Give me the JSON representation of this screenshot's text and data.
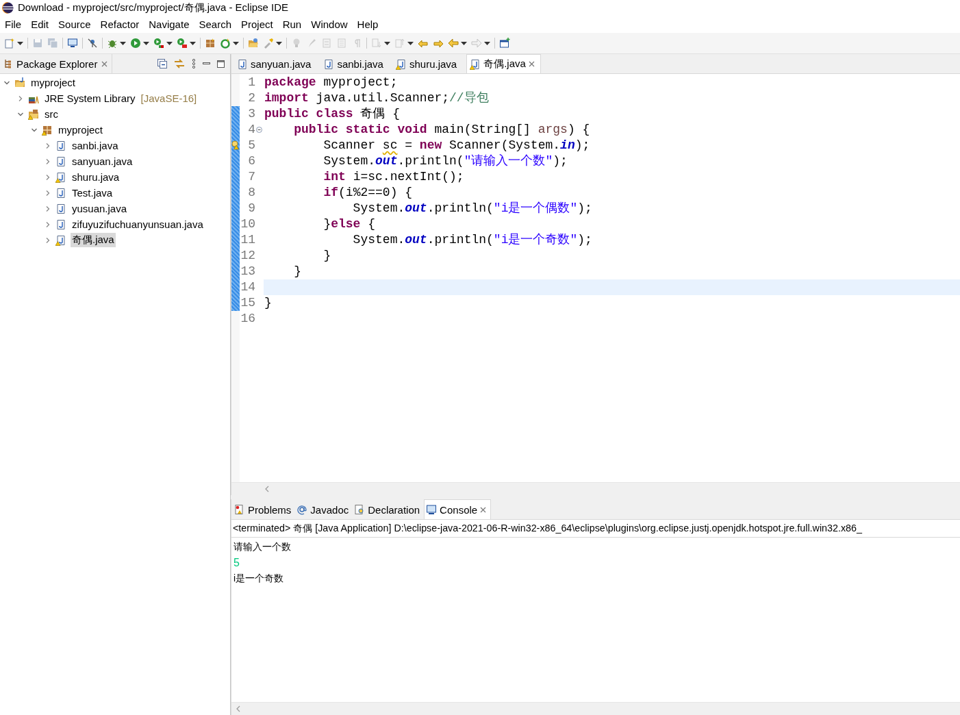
{
  "window": {
    "title": "Download - myproject/src/myproject/奇偶.java - Eclipse IDE"
  },
  "menu": [
    "File",
    "Edit",
    "Source",
    "Refactor",
    "Navigate",
    "Search",
    "Project",
    "Run",
    "Window",
    "Help"
  ],
  "toolbar": [
    {
      "kind": "new-document",
      "disabled": false,
      "menu": true,
      "separator_before": false
    },
    {
      "kind": "floppy-disk",
      "disabled": true,
      "menu": false,
      "separator_before": true
    },
    {
      "kind": "floppy-disks",
      "disabled": true,
      "menu": false,
      "separator_before": false
    },
    {
      "kind": "monitor",
      "disabled": false,
      "menu": false,
      "separator_before": true
    },
    {
      "kind": "crossed-pin",
      "disabled": false,
      "menu": false,
      "separator_before": true
    },
    {
      "kind": "bug",
      "disabled": false,
      "menu": true,
      "separator_before": true
    },
    {
      "kind": "play",
      "disabled": false,
      "menu": true,
      "separator_before": false
    },
    {
      "kind": "play-chart",
      "disabled": false,
      "menu": true,
      "separator_before": false
    },
    {
      "kind": "play-toolbox",
      "disabled": false,
      "menu": true,
      "separator_before": false
    },
    {
      "kind": "package-box",
      "disabled": false,
      "menu": false,
      "separator_before": true
    },
    {
      "kind": "circle-arrow",
      "disabled": false,
      "menu": true,
      "separator_before": false
    },
    {
      "kind": "open-folder",
      "disabled": false,
      "menu": false,
      "separator_before": true
    },
    {
      "kind": "flashlight",
      "disabled": false,
      "menu": true,
      "separator_before": false
    },
    {
      "kind": "lightbulb",
      "disabled": true,
      "menu": false,
      "separator_before": true
    },
    {
      "kind": "brush",
      "disabled": true,
      "menu": false,
      "separator_before": false
    },
    {
      "kind": "document-arrows",
      "disabled": true,
      "menu": false,
      "separator_before": false
    },
    {
      "kind": "document-lines",
      "disabled": true,
      "menu": false,
      "separator_before": false
    },
    {
      "kind": "pilcrow",
      "disabled": true,
      "menu": false,
      "separator_before": false
    },
    {
      "kind": "arrow-down-document",
      "disabled": true,
      "menu": true,
      "separator_before": true
    },
    {
      "kind": "arrow-up-document",
      "disabled": true,
      "menu": true,
      "separator_before": false
    },
    {
      "kind": "arrow-star-left",
      "disabled": false,
      "menu": false,
      "separator_before": false
    },
    {
      "kind": "arrow-star-right",
      "disabled": false,
      "menu": false,
      "separator_before": false
    },
    {
      "kind": "arrow-left",
      "disabled": false,
      "menu": true,
      "separator_before": false
    },
    {
      "kind": "arrow-right",
      "disabled": true,
      "menu": true,
      "separator_before": false
    },
    {
      "kind": "window-plus",
      "disabled": false,
      "menu": false,
      "separator_before": true
    }
  ],
  "package_explorer": {
    "title": "Package Explorer",
    "tree": [
      {
        "label": "myproject",
        "kind": "project",
        "expanded": true,
        "selected": false,
        "warning": false,
        "children": [
          {
            "label": "JRE System Library",
            "suffix": "[JavaSE-16]",
            "kind": "library",
            "expanded": false,
            "selected": false,
            "warning": false
          },
          {
            "label": "src",
            "kind": "source-folder",
            "expanded": true,
            "selected": false,
            "warning": true,
            "children": [
              {
                "label": "myproject",
                "kind": "package",
                "expanded": true,
                "selected": false,
                "warning": true,
                "children": [
                  {
                    "label": "sanbi.java",
                    "kind": "java-file",
                    "expanded": false,
                    "selected": false,
                    "warning": false
                  },
                  {
                    "label": "sanyuan.java",
                    "kind": "java-file",
                    "expanded": false,
                    "selected": false,
                    "warning": false
                  },
                  {
                    "label": "shuru.java",
                    "kind": "java-file",
                    "expanded": false,
                    "selected": false,
                    "warning": true
                  },
                  {
                    "label": "Test.java",
                    "kind": "java-file",
                    "expanded": false,
                    "selected": false,
                    "warning": false
                  },
                  {
                    "label": "yusuan.java",
                    "kind": "java-file",
                    "expanded": false,
                    "selected": false,
                    "warning": false
                  },
                  {
                    "label": "zifuyuzifuchuanyunsuan.java",
                    "kind": "java-file",
                    "expanded": false,
                    "selected": false,
                    "warning": false
                  },
                  {
                    "label": "奇偶.java",
                    "kind": "java-file",
                    "expanded": false,
                    "selected": true,
                    "warning": true
                  }
                ]
              }
            ]
          }
        ]
      }
    ]
  },
  "editor": {
    "tabs": [
      {
        "label": "sanyuan.java",
        "selected": false,
        "warning": false
      },
      {
        "label": "sanbi.java",
        "selected": false,
        "warning": false
      },
      {
        "label": "shuru.java",
        "selected": false,
        "warning": true
      },
      {
        "label": "奇偶.java",
        "selected": true,
        "warning": true
      }
    ],
    "lines": [
      {
        "number": "1",
        "current": false,
        "changed": false,
        "warning": false,
        "foldable": false,
        "tokens": [
          {
            "kind": "kw",
            "t": "package"
          },
          {
            "kind": "plain",
            "t": " myproject;"
          }
        ]
      },
      {
        "number": "2",
        "current": false,
        "changed": false,
        "warning": false,
        "foldable": false,
        "tokens": [
          {
            "kind": "kw",
            "t": "import"
          },
          {
            "kind": "plain",
            "t": " java.util.Scanner;"
          },
          {
            "kind": "comment",
            "t": "//导包"
          }
        ]
      },
      {
        "number": "3",
        "current": false,
        "changed": true,
        "warning": false,
        "foldable": false,
        "tokens": [
          {
            "kind": "kw",
            "t": "public class"
          },
          {
            "kind": "plain",
            "t": " 奇偶 {"
          }
        ]
      },
      {
        "number": "4",
        "current": false,
        "changed": true,
        "warning": false,
        "foldable": true,
        "tokens": [
          {
            "kind": "kw",
            "t": "    public static void"
          },
          {
            "kind": "plain",
            "t": " main(String[] "
          },
          {
            "kind": "param",
            "t": "args"
          },
          {
            "kind": "plain",
            "t": ") {"
          }
        ]
      },
      {
        "number": "5",
        "current": false,
        "changed": true,
        "warning": true,
        "foldable": false,
        "tokens": [
          {
            "kind": "plain",
            "t": "        Scanner "
          },
          {
            "kind": "warn",
            "t": "sc"
          },
          {
            "kind": "plain",
            "t": " = "
          },
          {
            "kind": "kw",
            "t": "new"
          },
          {
            "kind": "plain",
            "t": " Scanner(System."
          },
          {
            "kind": "field",
            "t": "in"
          },
          {
            "kind": "plain",
            "t": ");"
          }
        ]
      },
      {
        "number": "6",
        "current": false,
        "changed": true,
        "warning": false,
        "foldable": false,
        "tokens": [
          {
            "kind": "plain",
            "t": "        System."
          },
          {
            "kind": "field",
            "t": "out"
          },
          {
            "kind": "plain",
            "t": ".println("
          },
          {
            "kind": "string",
            "t": "\"请输入一个数\""
          },
          {
            "kind": "plain",
            "t": ");"
          }
        ]
      },
      {
        "number": "7",
        "current": false,
        "changed": true,
        "warning": false,
        "foldable": false,
        "tokens": [
          {
            "kind": "kw",
            "t": "        int"
          },
          {
            "kind": "plain",
            "t": " i=sc.nextInt();"
          }
        ]
      },
      {
        "number": "8",
        "current": false,
        "changed": true,
        "warning": false,
        "foldable": false,
        "tokens": [
          {
            "kind": "kw",
            "t": "        if"
          },
          {
            "kind": "plain",
            "t": "(i%2==0) {"
          }
        ]
      },
      {
        "number": "9",
        "current": false,
        "changed": true,
        "warning": false,
        "foldable": false,
        "tokens": [
          {
            "kind": "plain",
            "t": "            System."
          },
          {
            "kind": "field",
            "t": "out"
          },
          {
            "kind": "plain",
            "t": ".println("
          },
          {
            "kind": "string",
            "t": "\"i是一个偶数\""
          },
          {
            "kind": "plain",
            "t": ");"
          }
        ]
      },
      {
        "number": "10",
        "current": false,
        "changed": true,
        "warning": false,
        "foldable": false,
        "tokens": [
          {
            "kind": "plain",
            "t": "        }"
          },
          {
            "kind": "kw",
            "t": "else"
          },
          {
            "kind": "plain",
            "t": " {"
          }
        ]
      },
      {
        "number": "11",
        "current": false,
        "changed": true,
        "warning": false,
        "foldable": false,
        "tokens": [
          {
            "kind": "plain",
            "t": "            System."
          },
          {
            "kind": "field",
            "t": "out"
          },
          {
            "kind": "plain",
            "t": ".println("
          },
          {
            "kind": "string",
            "t": "\"i是一个奇数\""
          },
          {
            "kind": "plain",
            "t": ");"
          }
        ]
      },
      {
        "number": "12",
        "current": false,
        "changed": true,
        "warning": false,
        "foldable": false,
        "tokens": [
          {
            "kind": "plain",
            "t": "        }"
          }
        ]
      },
      {
        "number": "13",
        "current": false,
        "changed": true,
        "warning": false,
        "foldable": false,
        "tokens": [
          {
            "kind": "plain",
            "t": "    }"
          }
        ]
      },
      {
        "number": "14",
        "current": true,
        "changed": true,
        "warning": false,
        "foldable": false
      },
      {
        "number": "15",
        "current": false,
        "changed": true,
        "warning": false,
        "foldable": false,
        "tokens": [
          {
            "kind": "plain",
            "t": "}"
          }
        ]
      },
      {
        "number": "16",
        "current": false,
        "changed": false,
        "warning": false,
        "foldable": false
      }
    ]
  },
  "bottom_panel": {
    "tabs": [
      {
        "label": "Problems",
        "kind": "problems",
        "selected": false
      },
      {
        "label": "Javadoc",
        "kind": "javadoc",
        "selected": false
      },
      {
        "label": "Declaration",
        "kind": "declaration",
        "selected": false
      },
      {
        "label": "Console",
        "kind": "console",
        "selected": true
      }
    ],
    "console_header": "<terminated> 奇偶 [Java Application] D:\\eclipse-java-2021-06-R-win32-x86_64\\eclipse\\plugins\\org.eclipse.justj.openjdk.hotspot.jre.full.win32.x86_",
    "console_lines": [
      {
        "text": "请输入一个数",
        "kind": "output"
      },
      {
        "text": "5",
        "kind": "input"
      },
      {
        "text": "i是一个奇数",
        "kind": "output"
      }
    ]
  }
}
